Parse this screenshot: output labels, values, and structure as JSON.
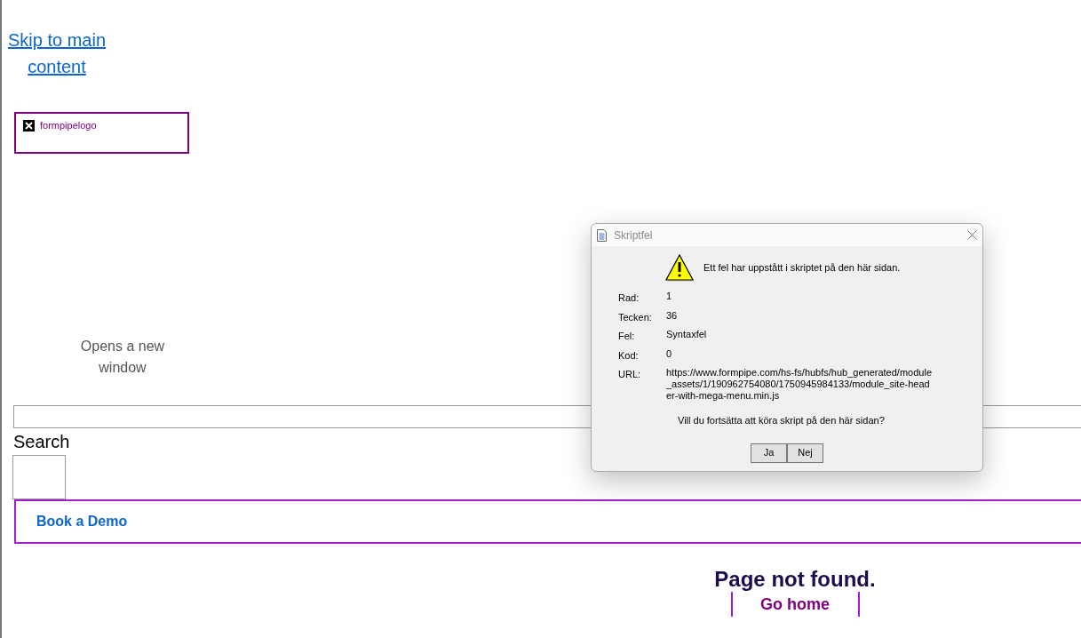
{
  "skip_link": "Skip to main content",
  "logo": {
    "alt_text": "formpipelogo"
  },
  "new_window_note": "Opens a new window",
  "search": {
    "label": "Search"
  },
  "book_demo": "Book a Demo",
  "not_found": {
    "heading": "Page not found.",
    "link": "Go home"
  },
  "dialog": {
    "title": "Skriptfel",
    "message": "Ett fel har uppstått i skriptet på den här sidan.",
    "fields": [
      {
        "label": "Rad:",
        "value": "1"
      },
      {
        "label": "Tecken:",
        "value": "36"
      },
      {
        "label": "Fel:",
        "value": "Syntaxfel"
      },
      {
        "label": "Kod:",
        "value": "0"
      },
      {
        "label": "URL:",
        "value": "https://www.formpipe.com/hs-fs/hubfs/hub_generated/module_assets/1/190962754080/1750945984133/module_site-header-with-mega-menu.min.js"
      }
    ],
    "question": "Vill du fortsätta att köra skript på den här sidan?",
    "buttons": [
      "Ja",
      "Nej"
    ]
  }
}
